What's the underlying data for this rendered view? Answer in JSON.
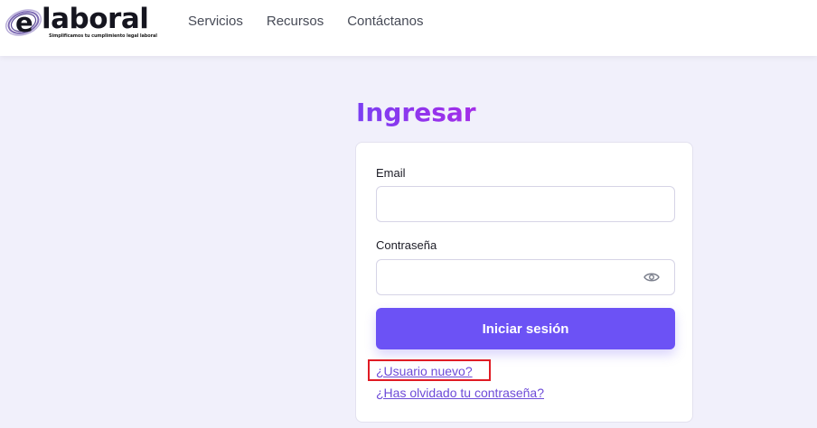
{
  "brand": {
    "logo_letter": "e",
    "logo_word": "laboral",
    "tagline": "Simplificamos tu cumplimiento legal laboral"
  },
  "nav": {
    "items": [
      "Servicios",
      "Recursos",
      "Contáctanos"
    ]
  },
  "login": {
    "title": "Ingresar",
    "email_label": "Email",
    "email_value": "",
    "password_label": "Contraseña",
    "password_value": "",
    "submit_label": "Iniciar sesión",
    "new_user_link": "¿Usuario nuevo?",
    "forgot_link": "¿Has olvidado tu contraseña?"
  },
  "icons": {
    "password_toggle": "eye-icon"
  },
  "colors": {
    "title_gradient_start": "#7b3ff2",
    "title_gradient_end": "#a42de8",
    "button": "#6c52f5",
    "link": "#6d4bd8",
    "highlight": "#e01b24",
    "background": "#f1f0fb"
  }
}
